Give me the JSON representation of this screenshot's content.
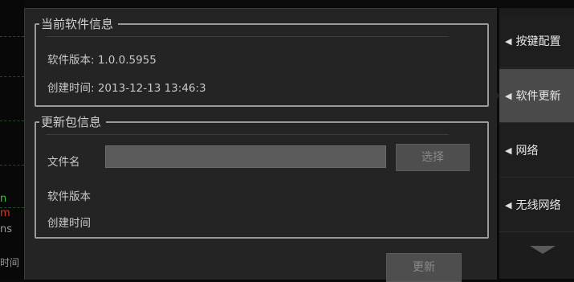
{
  "background_app": {
    "glyph_1": "n",
    "glyph_2": "m",
    "glyph_3": "ns",
    "glyph_4": "时间"
  },
  "current_info": {
    "title": "当前软件信息",
    "version_label": "软件版本: 1.0.0.5955",
    "created_label": "创建时间: 2013-12-13  13:46:3"
  },
  "update_package": {
    "title": "更新包信息",
    "filename_label": "文件名",
    "filename_value": "",
    "select_button": "选择",
    "version_label": "软件版本",
    "created_label": "创建时间"
  },
  "update_button": "更新",
  "menu": {
    "items": [
      {
        "label": "按键配置",
        "active": false
      },
      {
        "label": "软件更新",
        "active": true
      },
      {
        "label": "网络",
        "active": false
      },
      {
        "label": "无线网络",
        "active": false
      }
    ]
  },
  "colors": {
    "panel": "#242424",
    "menu_active": "#4a4a4a",
    "border": "#9a9a9a"
  }
}
